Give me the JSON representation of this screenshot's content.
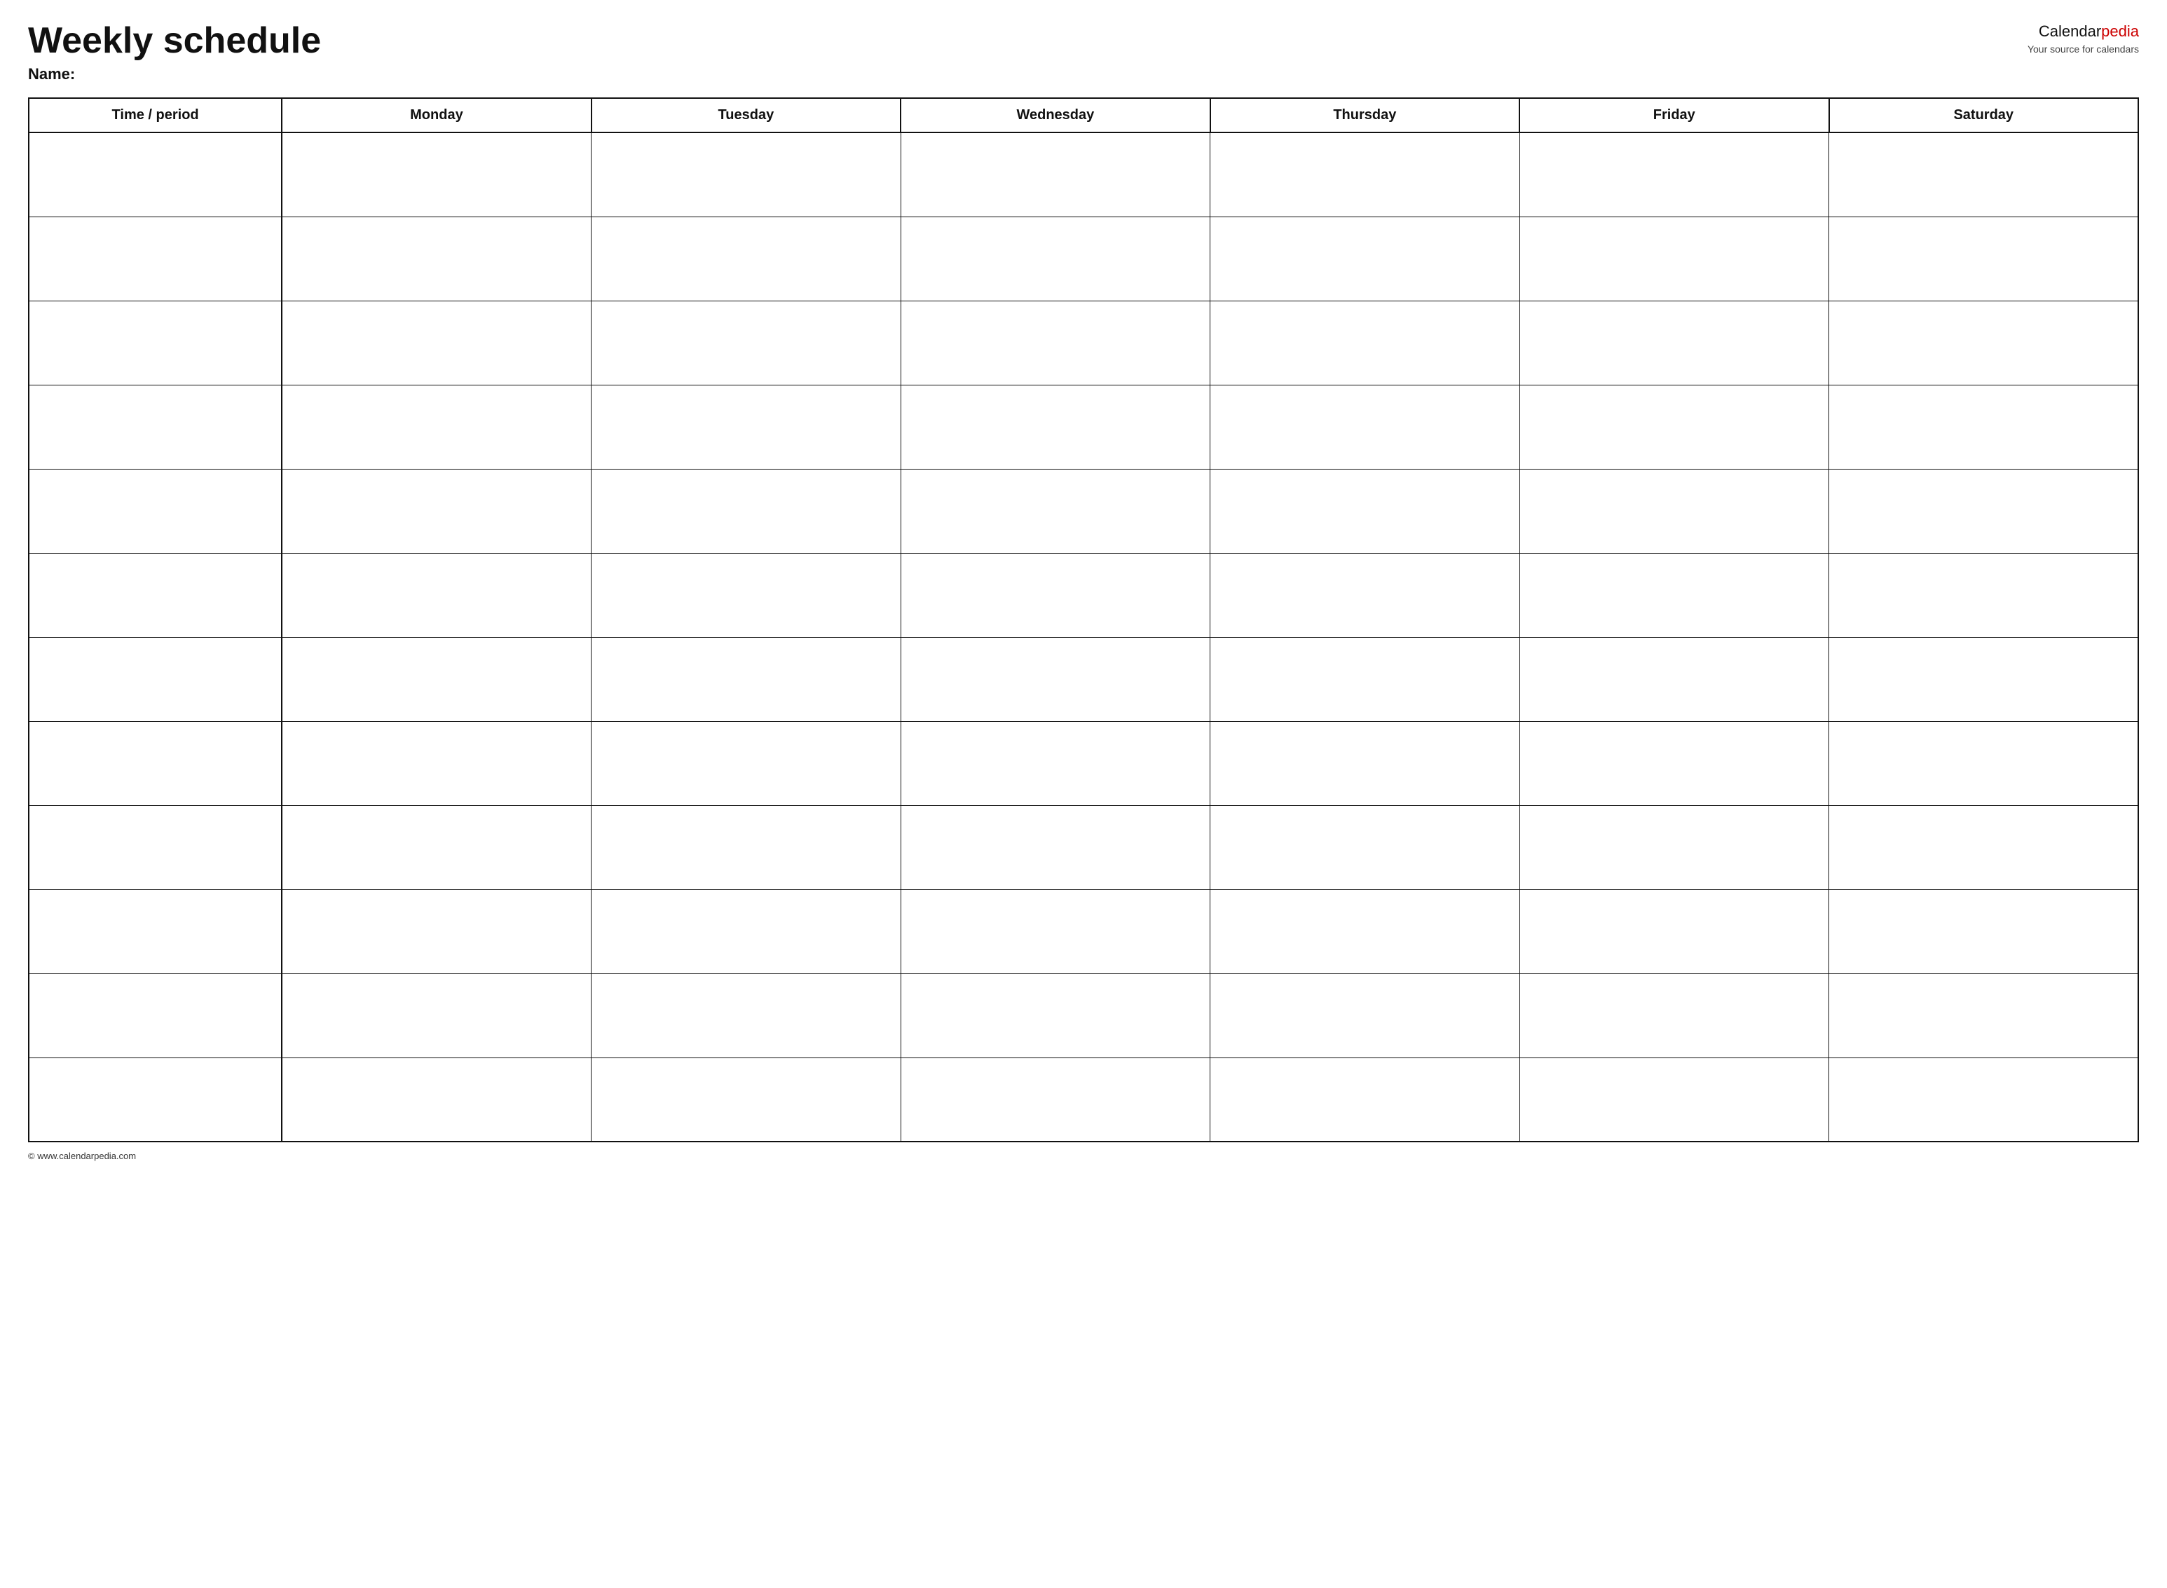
{
  "header": {
    "title": "Weekly schedule",
    "name_label": "Name:",
    "logo_text_1": "Calendar",
    "logo_text_2": "pedia",
    "logo_sub": "Your source for calendars"
  },
  "table": {
    "columns": [
      "Time / period",
      "Monday",
      "Tuesday",
      "Wednesday",
      "Thursday",
      "Friday",
      "Saturday"
    ],
    "row_count": 12
  },
  "footer": {
    "text": "© www.calendarpedia.com"
  }
}
